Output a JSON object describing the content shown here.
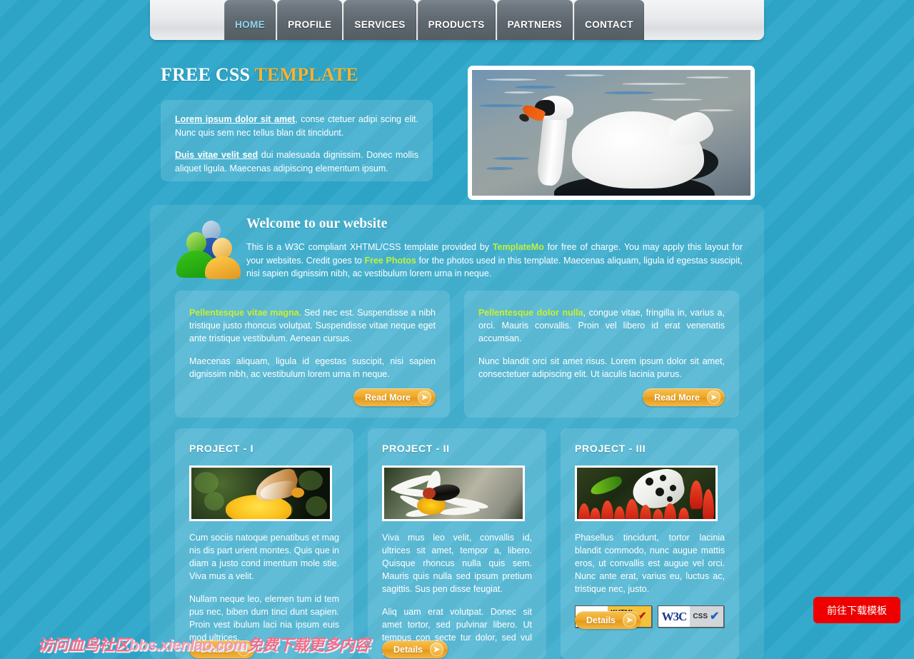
{
  "nav": {
    "items": [
      {
        "label": "HOME",
        "active": true
      },
      {
        "label": "PROFILE",
        "active": false
      },
      {
        "label": "SERVICES",
        "active": false
      },
      {
        "label": "PRODUCTS",
        "active": false
      },
      {
        "label": "PARTNERS",
        "active": false
      },
      {
        "label": "CONTACT",
        "active": false
      }
    ]
  },
  "header": {
    "title_main": "FREE CSS ",
    "title_accent": "TEMPLATE"
  },
  "intro": {
    "p1_link": "Lorem ipsum dolor sit amet",
    "p1_rest": ", conse ctetuer adipi scing elit. Nunc quis sem nec tellus blan dit tincidunt.",
    "p2_link": "Duis vitae velit sed",
    "p2_rest": " dui malesuada dignissim. Donec mollis aliquet ligula. Maecenas adipiscing elementum ipsum."
  },
  "hero": {
    "photo_alt": "swan-photo"
  },
  "welcome": {
    "heading": "Welcome to our website",
    "text_1": "This is a W3C compliant XHTML/CSS template provided by ",
    "link_1": "TemplateMo",
    "text_2": " for free of charge. You may apply this layout for your websites. Credit goes to ",
    "link_2": "Free Photos",
    "text_3": " for the photos used in this template. Maecenas aliquam, ligula id egestas suscipit, nisi sapien dignissim nibh, ac vestibulum lorem urna in neque."
  },
  "columns": [
    {
      "lead": "Pellentesque vitae magna.",
      "p1_rest": " Sed nec est. Suspendisse a nibh tristique justo rhoncus volutpat. Suspendisse vitae neque eget ante tristique vestibulum. Aenean cursus.",
      "p2": "Maecenas aliquam, ligula id egestas suscipit, nisi sapien dignissim nibh, ac vestibulum lorem urna in neque.",
      "button": "Read More"
    },
    {
      "lead": "Pellentesque dolor nulla",
      "p1_rest": ", congue vitae, fringilla in, varius a, orci. Mauris convallis. Proin vel libero id erat venenatis accumsan.",
      "p2": "Nunc blandit orci sit amet risus. Lorem ipsum dolor sit amet, consectetuer adipiscing elit. Ut iaculis lacinia purus.",
      "button": "Read More"
    }
  ],
  "projects": [
    {
      "title": "PROJECT - I",
      "image": "butterfly-on-yellow-flower-thumbnail",
      "p1": "Cum sociis natoque penatibus et mag nis dis part urient montes. Quis que in diam a justo cond imentum mole stie. Viva mus a velit.",
      "p2": "Nullam neque leo, elemen tum id tem pus nec, biben dum tinci dunt sapien. Proin vest ibulum laci nia ipsum euis mod ultrices.",
      "button": "Details"
    },
    {
      "title": "PROJECT - II",
      "image": "beetle-on-white-daisy-thumbnail",
      "p1": "Viva mus leo velit, convallis id, ultrices sit amet, tempor a, libero. Quisque rhoncus nulla quis sem. Mauris quis nulla sed ipsum pretium sagittis. Sus pen disse feugiat.",
      "p2": "Aliq uam erat volutpat. Donec sit amet tortor, sed pulvinar libero. Ut tempus con secte tur dolor, sed vul put ate nul.",
      "button": "Details"
    },
    {
      "title": "PROJECT - III",
      "image": "white-butterfly-on-red-flowers-thumbnail",
      "p1": "Phasellus tincidunt, tortor lacinia blandit commodo, nunc augue mattis eros, ut convallis est augue vel orci. Nunc ante erat, varius eu, luctus ac, tristique nec, justo.",
      "p2": "",
      "button": "Details"
    }
  ],
  "badges": {
    "xhtml": {
      "w3c": "W3C",
      "line1": "XHTML",
      "line2": "1.0",
      "check": "✔"
    },
    "css": {
      "w3c": "W3C",
      "line1": "CSS",
      "check": "✔"
    }
  },
  "watermark": {
    "cn_prefix": "访问血鸟社区",
    "url": "bbs.xienIao.com",
    "cn_suffix": "免费下载更多内容"
  },
  "float_button": {
    "label": "前往下载模板"
  },
  "colors": {
    "background": "#2ea7ca",
    "accent_orange": "#f6b233",
    "link_green": "#bff23a",
    "nav_tab": "#5f686f",
    "active_nav": "#8fd7f0",
    "download_red": "#ee0000"
  }
}
